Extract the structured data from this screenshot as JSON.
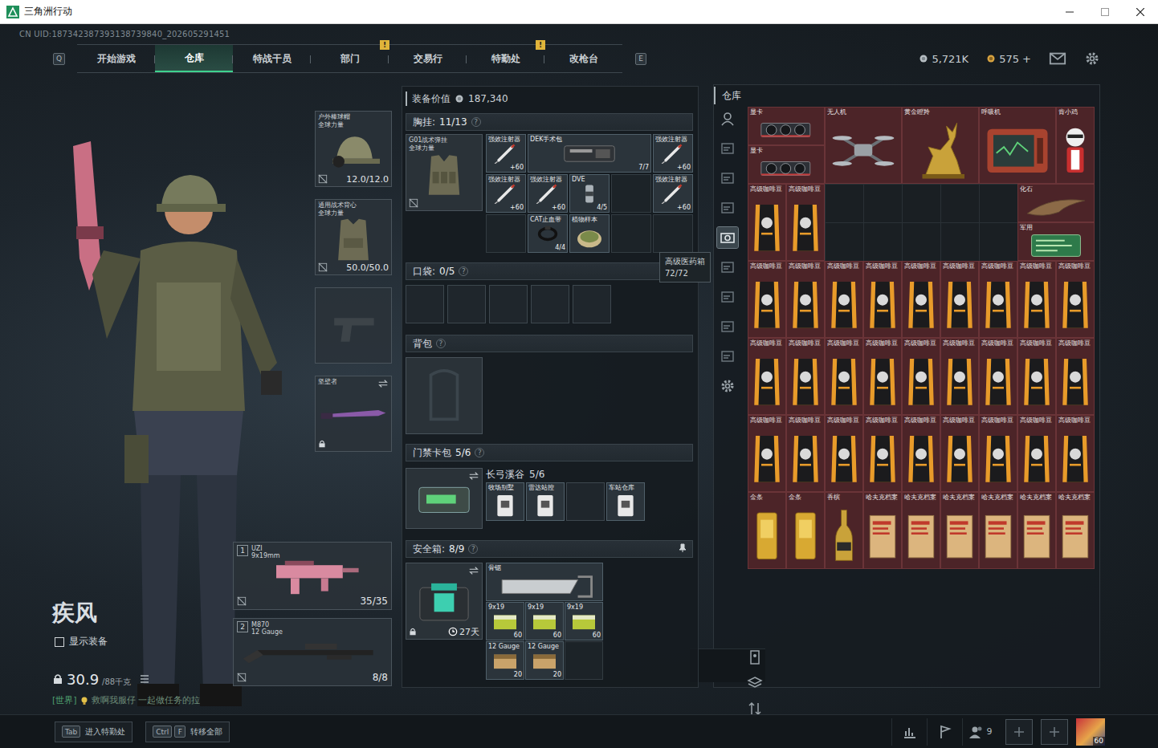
{
  "window": {
    "title": "三角洲行动"
  },
  "uid": "CN UID:187342387393138739840_202605291451",
  "nav": {
    "keys": [
      "Q",
      "E"
    ],
    "tabs": [
      {
        "label": "开始游戏",
        "selected": false
      },
      {
        "label": "仓库",
        "selected": true
      },
      {
        "label": "特战干员",
        "selected": false
      },
      {
        "label": "部门",
        "selected": false,
        "badge": "!"
      },
      {
        "label": "交易行",
        "selected": false
      },
      {
        "label": "特勤处",
        "selected": false,
        "badge": "!"
      },
      {
        "label": "改枪台",
        "selected": false
      }
    ]
  },
  "currencies": [
    {
      "kind": "coin",
      "value": "5,721K"
    },
    {
      "kind": "bond",
      "value": "575 +"
    }
  ],
  "operator": {
    "name": "疾风",
    "show_gear": {
      "label": "显示装备",
      "checked": false
    },
    "weight": "30.9",
    "weight_max": "/88千克"
  },
  "chat": {
    "channel": "[世界]",
    "message": "救啊我服仔 一起做任务的拉"
  },
  "gear_slots": [
    {
      "kind": "helmet",
      "name": "户外棒球帽",
      "sub": "全球力量",
      "value": "12.0/12.0"
    },
    {
      "kind": "armor",
      "name": "通用战术背心",
      "sub": "全球力量",
      "value": "50.0/50.0"
    },
    {
      "kind": "pistol"
    },
    {
      "kind": "melee",
      "name": "坚壁者"
    }
  ],
  "weapons": [
    {
      "kind": "smg",
      "index": "1",
      "name": "UZI",
      "caliber": "9x19mm",
      "ammo": "35/35"
    },
    {
      "kind": "shotgun",
      "index": "2",
      "name": "M870",
      "caliber": "12 Gauge",
      "ammo": "8/8"
    }
  ],
  "loadout": {
    "value_label": "装备价值",
    "value": "187,340",
    "chest": {
      "label": "胸挂:",
      "count": "11/13",
      "help": "?",
      "rig": {
        "name": "G01战术弹挂",
        "sub": "全球力量"
      },
      "items": [
        {
          "kind": "syringe",
          "name": "强效注射器",
          "count": "+60"
        },
        {
          "kind": "surgery",
          "name": "DEK手术包",
          "count": "7/7"
        },
        {
          "kind": "syringe",
          "name": "强效注射器",
          "count": "+60"
        },
        {
          "kind": "syringe",
          "name": "强效注射器",
          "count": "+60"
        },
        {
          "kind": "syringe",
          "name": "强效注射器",
          "count": "+60"
        },
        {
          "kind": "injector",
          "name": "DVE",
          "count": "4/5"
        },
        {
          "kind": "syringe",
          "name": "强效注射器",
          "count": "+60"
        },
        {
          "kind": "tourniquet",
          "name": "CAT止血带",
          "count": "4/4"
        },
        {
          "kind": "sample",
          "name": "植物样本"
        }
      ]
    },
    "pockets": {
      "label": "口袋:",
      "count": "0/5",
      "help": "?",
      "empty_slots": 5
    },
    "backpack": {
      "label": "背包",
      "help": "?"
    },
    "keycards": {
      "label": "门禁卡包",
      "help": "?",
      "map": "长弓溪谷",
      "count": "5/6",
      "cards": [
        {
          "name": "牧场别墅",
          "empty": false
        },
        {
          "name": "雷达站控",
          "empty": false
        },
        {
          "empty": true
        },
        {
          "name": "车站仓库",
          "empty": false
        }
      ]
    },
    "safebox": {
      "label": "安全箱:",
      "count": "8/9",
      "help": "?",
      "timer": "27天",
      "items": [
        {
          "kind": "saw",
          "name": "骨锯"
        },
        {
          "kind": "ammo9",
          "name": "9x19",
          "count": "60"
        },
        {
          "kind": "ammo9",
          "name": "9x19",
          "count": "60"
        },
        {
          "kind": "ammo9",
          "name": "9x19",
          "count": "60"
        },
        {
          "kind": "ammo12",
          "name": "12 Gauge",
          "count": "20"
        },
        {
          "kind": "ammo12",
          "name": "12 Gauge",
          "count": "20"
        }
      ]
    }
  },
  "tooltip": {
    "name": "高级医药箱",
    "value": "72/72"
  },
  "warehouse": {
    "title": "仓库",
    "side": [
      {
        "kind": "person",
        "selected": false
      },
      {
        "kind": "tab",
        "selected": false
      },
      {
        "kind": "tab",
        "selected": false
      },
      {
        "kind": "tab",
        "selected": false
      },
      {
        "kind": "camera",
        "selected": true
      },
      {
        "kind": "tab",
        "selected": false
      },
      {
        "kind": "tab",
        "selected": false
      },
      {
        "kind": "tab",
        "selected": false
      },
      {
        "kind": "tab",
        "selected": false
      },
      {
        "kind": "gear",
        "selected": false
      }
    ],
    "side_bottom": [
      {
        "kind": "tower"
      },
      {
        "kind": "layers"
      },
      {
        "kind": "sort"
      }
    ],
    "rows": [
      {
        "items": [
          {
            "kind": "stack",
            "items": [
              {
                "kind": "gpu",
                "name": "显卡"
              },
              {
                "kind": "gpu",
                "name": "显卡"
              }
            ]
          },
          {
            "kind": "drone",
            "name": "无人机"
          },
          {
            "kind": "statue",
            "name": "黄金瞪羚"
          },
          {
            "kind": "monitor",
            "name": "呼吸机"
          },
          {
            "kind": "figure",
            "name": "肯小鸡"
          }
        ]
      },
      {
        "items": [
          {
            "kind": "coffee",
            "name": "高级咖啡豆"
          },
          {
            "kind": "coffee",
            "name": "高级咖啡豆"
          },
          {
            "kind": "stack",
            "items": [
              {
                "kind": "fossil",
                "name": "化石"
              },
              {
                "kind": "board",
                "name": "军用"
              }
            ]
          }
        ]
      },
      {
        "items": [
          {
            "kind": "coffee",
            "name": "高级咖啡豆"
          },
          {
            "kind": "coffee",
            "name": "高级咖啡豆"
          },
          {
            "kind": "coffee",
            "name": "高级咖啡豆"
          },
          {
            "kind": "coffee",
            "name": "高级咖啡豆"
          },
          {
            "kind": "coffee",
            "name": "高级咖啡豆"
          },
          {
            "kind": "coffee",
            "name": "高级咖啡豆"
          },
          {
            "kind": "coffee",
            "name": "高级咖啡豆"
          },
          {
            "kind": "coffee",
            "name": "高级咖啡豆"
          },
          {
            "kind": "coffee",
            "name": "高级咖啡豆"
          }
        ]
      },
      {
        "items": [
          {
            "kind": "coffee",
            "name": "高级咖啡豆"
          },
          {
            "kind": "coffee",
            "name": "高级咖啡豆"
          },
          {
            "kind": "coffee",
            "name": "高级咖啡豆"
          },
          {
            "kind": "coffee",
            "name": "高级咖啡豆"
          },
          {
            "kind": "coffee",
            "name": "高级咖啡豆"
          },
          {
            "kind": "coffee",
            "name": "高级咖啡豆"
          },
          {
            "kind": "coffee",
            "name": "高级咖啡豆"
          },
          {
            "kind": "coffee",
            "name": "高级咖啡豆"
          },
          {
            "kind": "coffee",
            "name": "高级咖啡豆"
          }
        ]
      },
      {
        "items": [
          {
            "kind": "coffee",
            "name": "高级咖啡豆"
          },
          {
            "kind": "coffee",
            "name": "高级咖啡豆"
          },
          {
            "kind": "coffee",
            "name": "高级咖啡豆"
          },
          {
            "kind": "coffee",
            "name": "高级咖啡豆"
          },
          {
            "kind": "coffee",
            "name": "高级咖啡豆"
          },
          {
            "kind": "coffee",
            "name": "高级咖啡豆"
          },
          {
            "kind": "coffee",
            "name": "高级咖啡豆"
          },
          {
            "kind": "coffee",
            "name": "高级咖啡豆"
          },
          {
            "kind": "coffee",
            "name": "高级咖啡豆"
          }
        ]
      },
      {
        "items": [
          {
            "kind": "gold",
            "name": "金条"
          },
          {
            "kind": "gold",
            "name": "金条"
          },
          {
            "kind": "bottle",
            "name": "香槟"
          },
          {
            "kind": "file",
            "name": "哈夫克档案"
          },
          {
            "kind": "file",
            "name": "哈夫克档案"
          },
          {
            "kind": "file",
            "name": "哈夫克档案"
          },
          {
            "kind": "file",
            "name": "哈夫克档案"
          },
          {
            "kind": "file",
            "name": "哈夫克档案"
          },
          {
            "kind": "file",
            "name": "哈夫克档案"
          }
        ]
      }
    ]
  },
  "bottom": {
    "hints": [
      {
        "keys": [
          "Tab"
        ],
        "label": "进入特勤处"
      },
      {
        "keys": [
          "Ctrl",
          "F"
        ],
        "label": "转移全部"
      }
    ],
    "friends": "9",
    "level": "60"
  }
}
